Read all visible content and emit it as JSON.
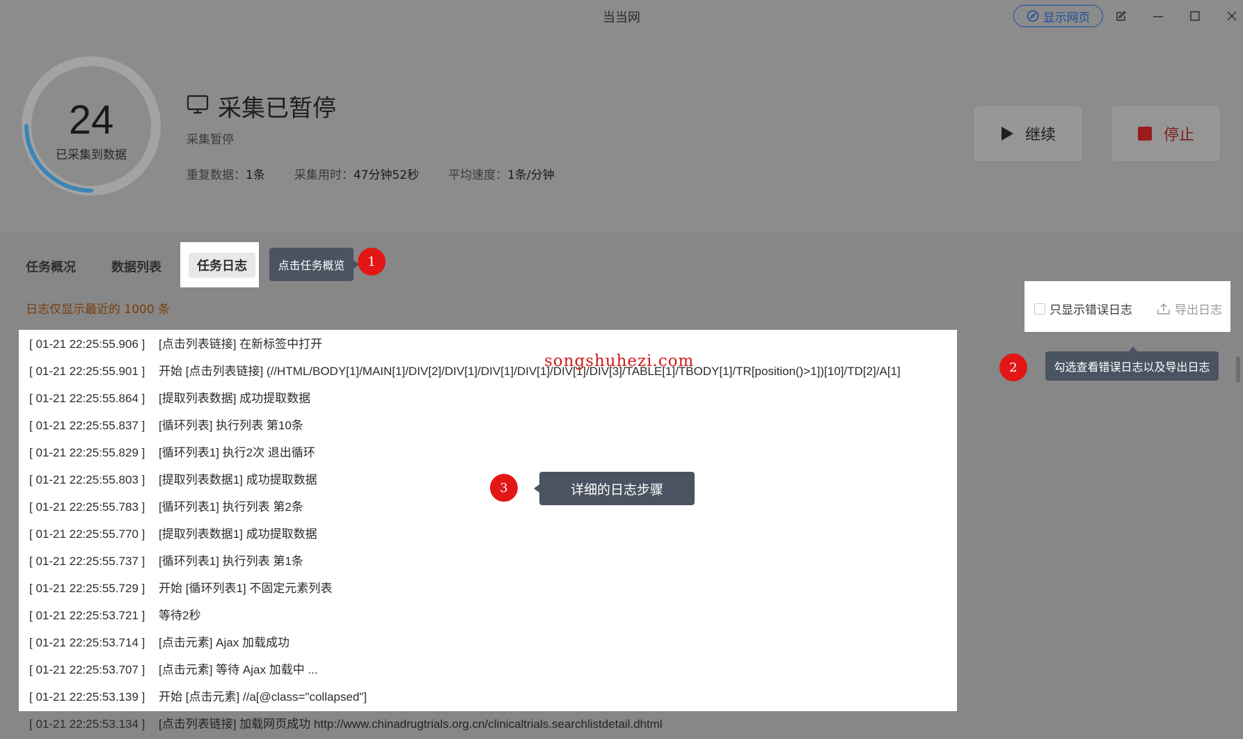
{
  "window": {
    "title": "当当网",
    "show_web_label": "显示网页"
  },
  "status": {
    "count": "24",
    "count_label": "已采集到数据",
    "title": "采集已暂停",
    "subtitle": "采集暂停",
    "stats": [
      {
        "label": "重复数据：",
        "value": "1条"
      },
      {
        "label": "采集用时：",
        "value": "47分钟52秒"
      },
      {
        "label": "平均速度：",
        "value": "1条/分钟"
      }
    ],
    "continue_label": "继续",
    "stop_label": "停止"
  },
  "tabs": [
    {
      "label": "任务概况"
    },
    {
      "label": "数据列表"
    },
    {
      "label": "任务日志"
    }
  ],
  "annotations": {
    "tip1": "点击任务概览",
    "tip2": "勾选查看错误日志以及导出日志",
    "tip3": "详细的日志步骤",
    "badge1": "1",
    "badge2": "2",
    "badge3": "3"
  },
  "log": {
    "notice": "日志仅显示最近的 1000 条",
    "only_errors_label": "只显示错误日志",
    "export_label": "导出日志",
    "entries": [
      {
        "ts": "[ 01-21 22:25:55.906 ]",
        "msg": "[点击列表链接] 在新标签中打开"
      },
      {
        "ts": "[ 01-21 22:25:55.901 ]",
        "msg": "开始 [点击列表链接] (//HTML/BODY[1]/MAIN[1]/DIV[2]/DIV[1]/DIV[1]/DIV[1]/DIV[1]/DIV[3]/TABLE[1]/TBODY[1]/TR[position()>1])[10]/TD[2]/A[1]"
      },
      {
        "ts": "[ 01-21 22:25:55.864 ]",
        "msg": "[提取列表数据] 成功提取数据"
      },
      {
        "ts": "[ 01-21 22:25:55.837 ]",
        "msg": "[循环列表] 执行列表 第10条"
      },
      {
        "ts": "[ 01-21 22:25:55.829 ]",
        "msg": "[循环列表1] 执行2次 退出循环"
      },
      {
        "ts": "[ 01-21 22:25:55.803 ]",
        "msg": "[提取列表数据1] 成功提取数据"
      },
      {
        "ts": "[ 01-21 22:25:55.783 ]",
        "msg": "[循环列表1] 执行列表 第2条"
      },
      {
        "ts": "[ 01-21 22:25:55.770 ]",
        "msg": "[提取列表数据1] 成功提取数据"
      },
      {
        "ts": "[ 01-21 22:25:55.737 ]",
        "msg": "[循环列表1] 执行列表 第1条"
      },
      {
        "ts": "[ 01-21 22:25:55.729 ]",
        "msg": "开始 [循环列表1] 不固定元素列表"
      },
      {
        "ts": "[ 01-21 22:25:53.721 ]",
        "msg": "等待2秒"
      },
      {
        "ts": "[ 01-21 22:25:53.714 ]",
        "msg": "[点击元素] Ajax 加载成功"
      },
      {
        "ts": "[ 01-21 22:25:53.707 ]",
        "msg": "[点击元素] 等待 Ajax 加载中 ..."
      },
      {
        "ts": "[ 01-21 22:25:53.139 ]",
        "msg": "开始 [点击元素] //a[@class=\"collapsed\"]"
      },
      {
        "ts": "[ 01-21 22:25:53.134 ]",
        "msg": "[点击列表链接] 加载网页成功 http://www.chinadrugtrials.org.cn/clinicaltrials.searchlistdetail.dhtml"
      }
    ]
  },
  "watermark": "songshuhezi.com",
  "colors": {
    "accent_blue": "#1f4f9e",
    "stop_red": "#c81f1f",
    "badge_red": "#e31616",
    "tooltip_bg": "#4a5361",
    "notice_orange": "#7a3d0c"
  }
}
